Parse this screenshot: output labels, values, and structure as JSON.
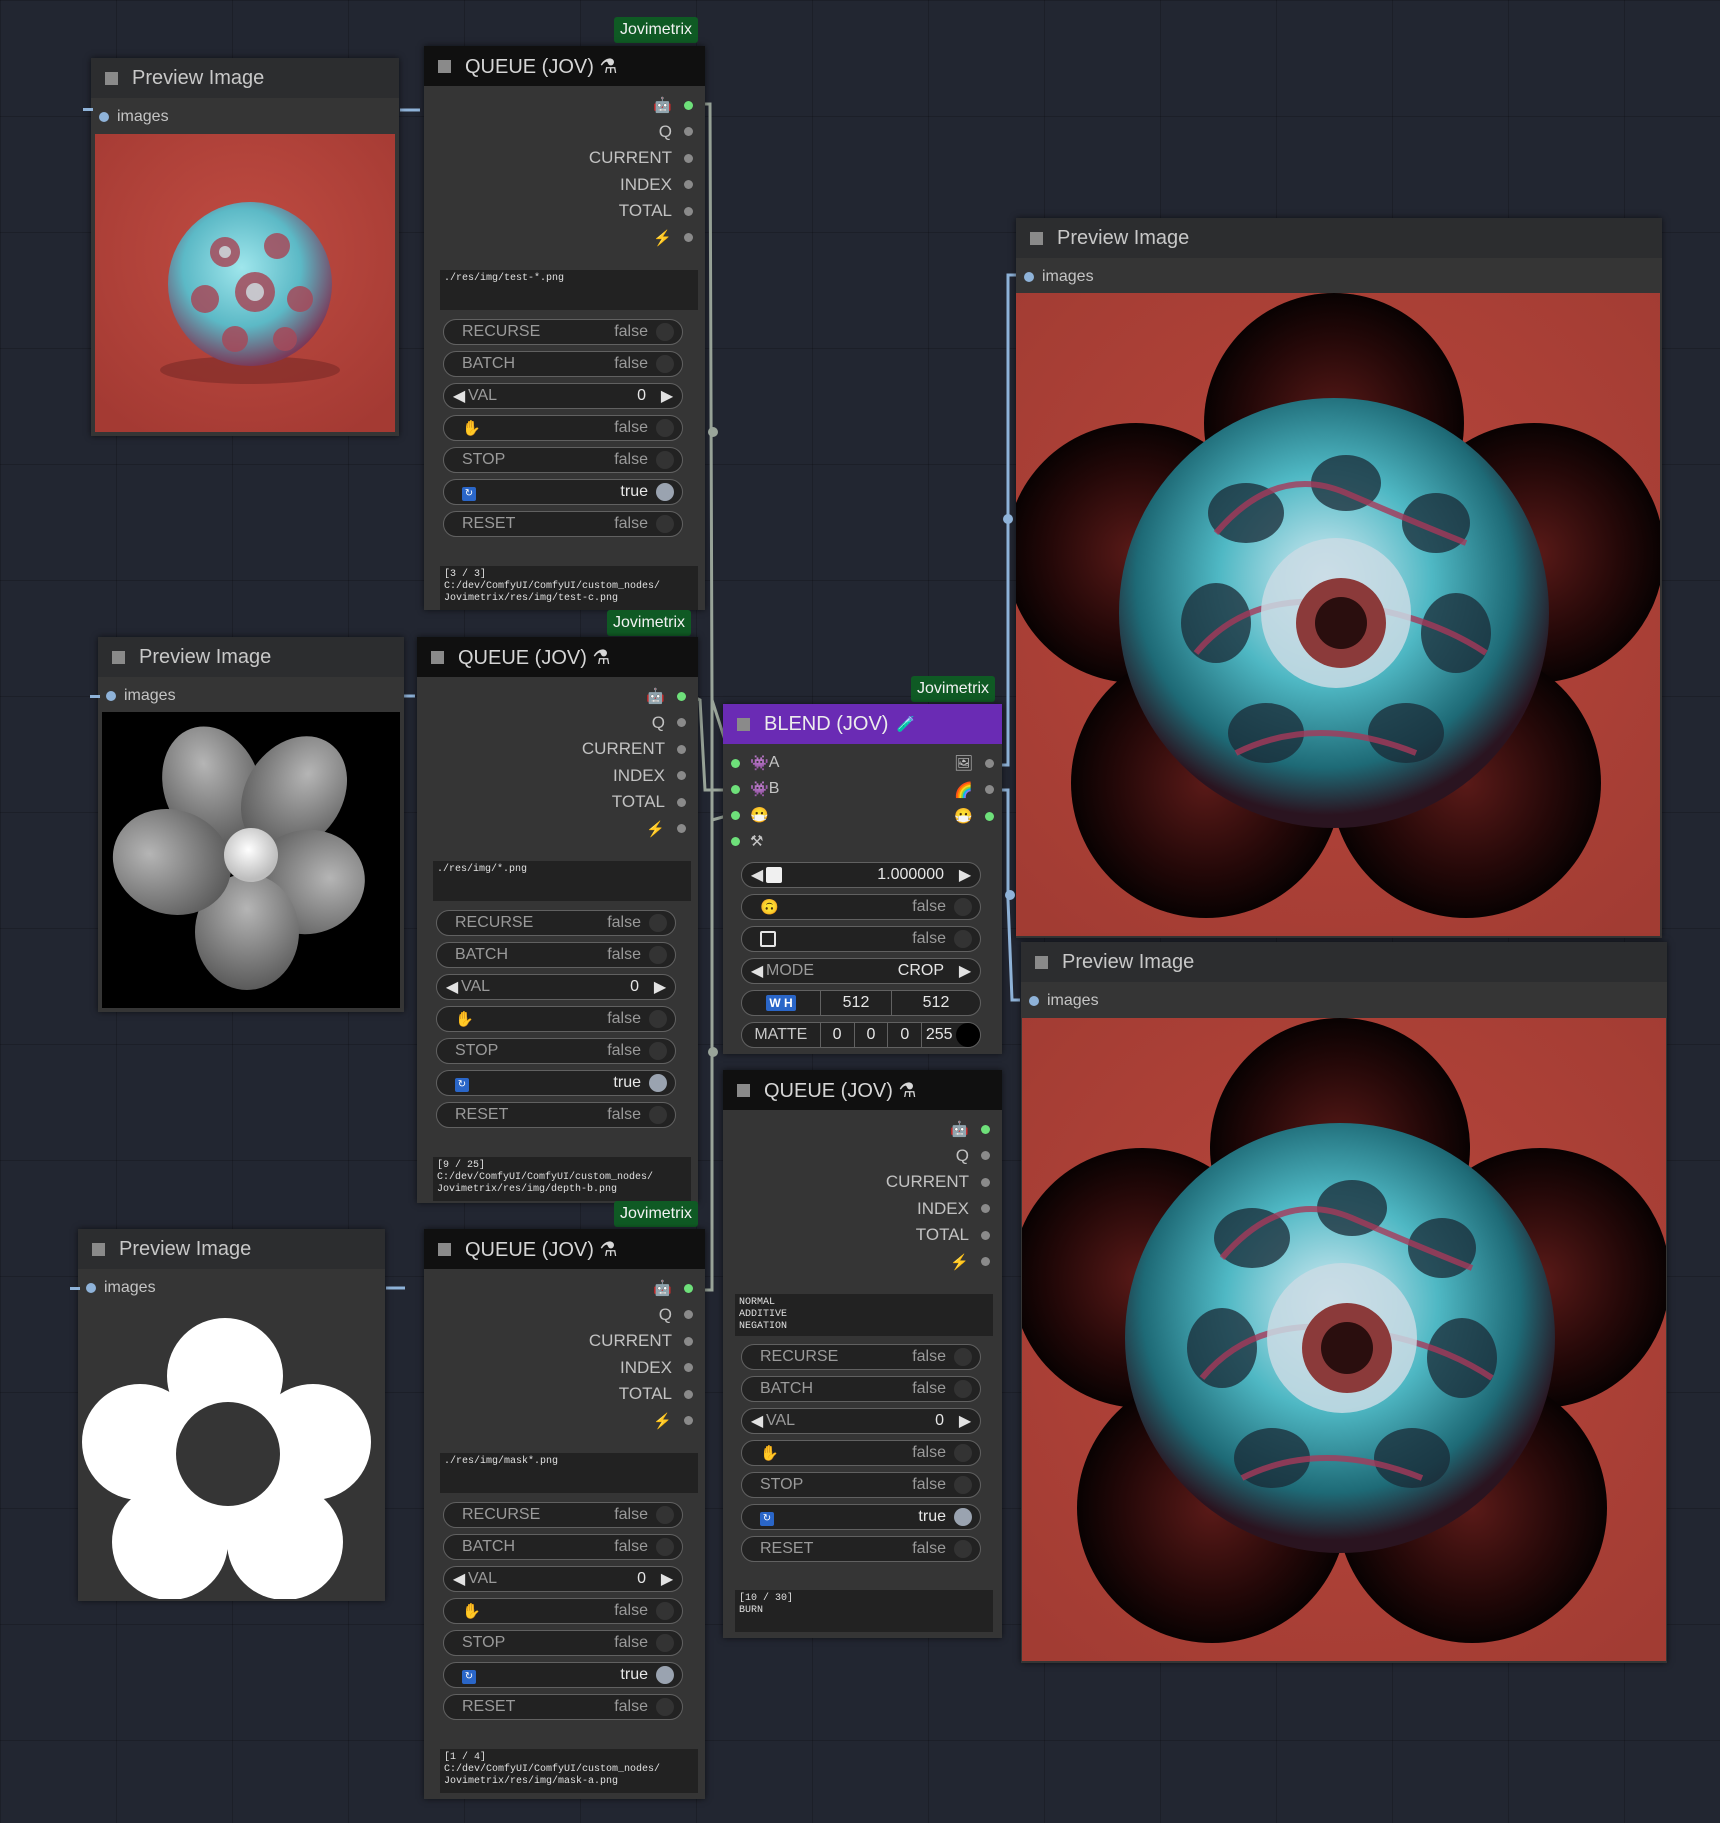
{
  "preview": {
    "title": "Preview Image",
    "input_label": "images"
  },
  "queue": {
    "title": "QUEUE (JOV) ⚗",
    "badge": "Jovimetrix",
    "outputs": [
      "Q",
      "CURRENT",
      "INDEX",
      "TOTAL"
    ],
    "recurse": "RECURSE",
    "batch": "BATCH",
    "val": "VAL",
    "stop": "STOP",
    "reset": "RESET",
    "false": "false",
    "true": "true",
    "zero": "0"
  },
  "queue1": {
    "path": "./res/img/test-*.png",
    "status": "[3 / 3]\nC:/dev/ComfyUI/ComfyUI/custom_nodes/\nJovimetrix/res/img/test-c.png"
  },
  "queue2": {
    "path": "./res/img/*.png",
    "status": "[9 / 25]\nC:/dev/ComfyUI/ComfyUI/custom_nodes/\nJovimetrix/res/img/depth-b.png"
  },
  "queue3": {
    "path": "./res/img/mask*.png",
    "status": "[1 / 4]\nC:/dev/ComfyUI/ComfyUI/custom_nodes/\nJovimetrix/res/img/mask-a.png"
  },
  "queue4": {
    "path": "NORMAL\nADDITIVE\nNEGATION",
    "status": "[10 / 30]\nBURN"
  },
  "blend": {
    "title": "BLEND (JOV)",
    "badge": "Jovimetrix",
    "input_a": "A",
    "input_b": "B",
    "alpha_value": "1.000000",
    "false": "false",
    "mode_label": "MODE",
    "mode_value": "CROP",
    "wh_label": "W H",
    "width": "512",
    "height": "512",
    "matte_label": "MATTE",
    "matte_r": "0",
    "matte_g": "0",
    "matte_b": "0",
    "matte_a": "255"
  },
  "colors": {
    "background": "#222631",
    "node": "#353535",
    "blend_title": "#6a2bb4",
    "badge": "#0f5a24",
    "slot_green": "#6ee07a",
    "image_red": "#a8433b"
  },
  "icons": [
    "robot-icon",
    "lightning-icon",
    "hand-icon",
    "loop-icon",
    "image-icon",
    "rainbow-icon",
    "smiley-icon",
    "tools-icon",
    "potion-icon"
  ]
}
